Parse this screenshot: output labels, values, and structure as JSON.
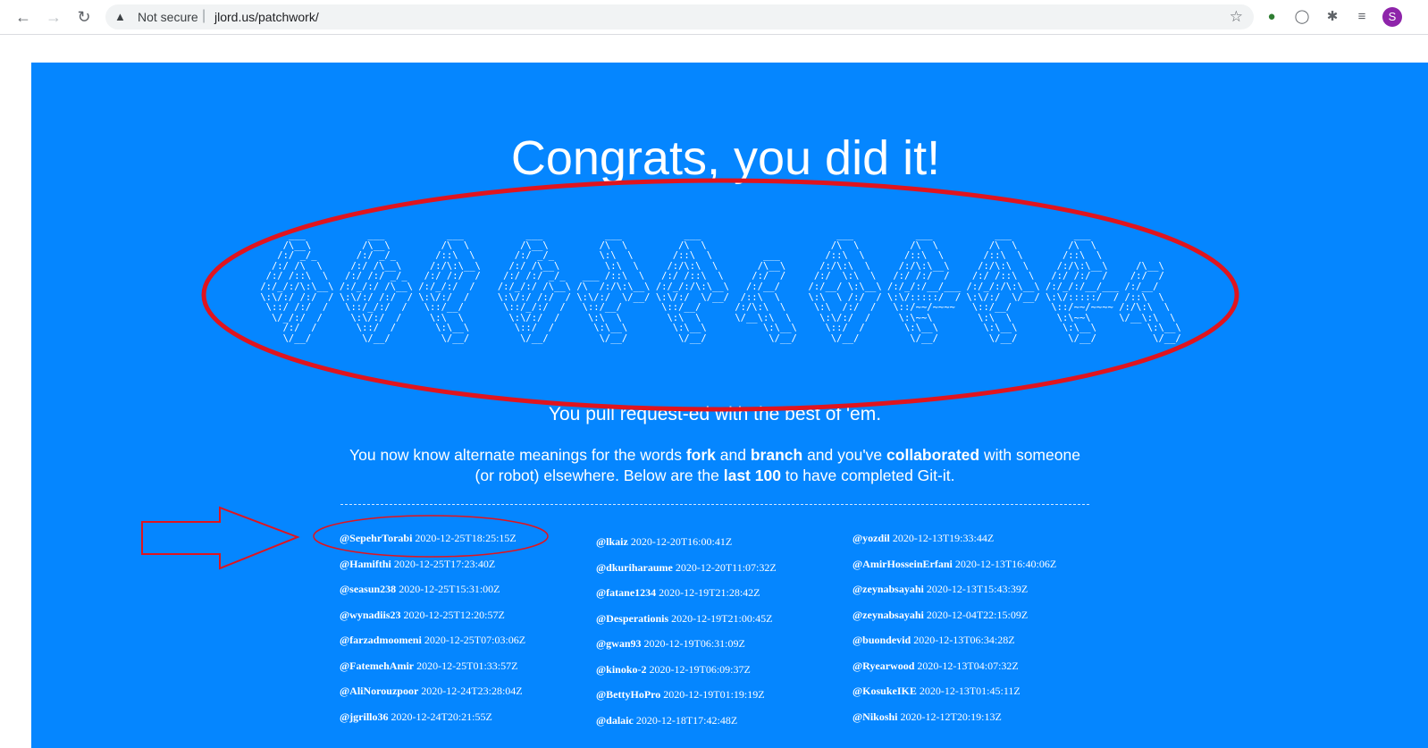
{
  "browser": {
    "back_icon": "arrow-left-icon",
    "forward_icon": "arrow-right-icon",
    "reload_icon": "reload-icon",
    "security_label": "Not secure",
    "separator": "|",
    "url": "jlord.us/patchwork/",
    "profile_initial": "S"
  },
  "page": {
    "title": "Congrats, you did it!",
    "subtitle_prefix": "You ",
    "subtitle_bold": "pull request",
    "subtitle_suffix": "-ed with the best of 'em.",
    "desc_1": "You now know alternate meanings for the words ",
    "desc_fork": "fork",
    "desc_2": " and ",
    "desc_branch": "branch",
    "desc_3": " and you've ",
    "desc_collab": "collaborated",
    "desc_4": " with someone (or robot) elsewhere. Below are the ",
    "desc_last": "last 100",
    "desc_5": " to have completed Git-it.",
    "background_color": "#0586ff"
  },
  "contributors": {
    "col1": [
      {
        "user": "@SepehrTorabi",
        "time": "2020-12-25T18:25:15Z"
      },
      {
        "user": "@Hamifthi",
        "time": "2020-12-25T17:23:40Z"
      },
      {
        "user": "@seasun238",
        "time": "2020-12-25T15:31:00Z"
      },
      {
        "user": "@wynadiis23",
        "time": "2020-12-25T12:20:57Z"
      },
      {
        "user": "@farzadmoomeni",
        "time": "2020-12-25T07:03:06Z"
      },
      {
        "user": "@FatemehAmir",
        "time": "2020-12-25T01:33:57Z"
      },
      {
        "user": "@AliNorouzpoor",
        "time": "2020-12-24T23:28:04Z"
      },
      {
        "user": "@jgrillo36",
        "time": "2020-12-24T20:21:55Z"
      }
    ],
    "col2": [
      {
        "user": "@lkaiz",
        "time": "2020-12-20T16:00:41Z"
      },
      {
        "user": "@dkuriharaume",
        "time": "2020-12-20T11:07:32Z"
      },
      {
        "user": "@fatane1234",
        "time": "2020-12-19T21:28:42Z"
      },
      {
        "user": "@Desperationis",
        "time": "2020-12-19T21:00:45Z"
      },
      {
        "user": "@gwan93",
        "time": "2020-12-19T06:31:09Z"
      },
      {
        "user": "@kinoko-2",
        "time": "2020-12-19T06:09:37Z"
      },
      {
        "user": "@BettyHoPro",
        "time": "2020-12-19T01:19:19Z"
      },
      {
        "user": "@dalaic",
        "time": "2020-12-18T17:42:48Z"
      }
    ],
    "col3": [
      {
        "user": "@yozdil",
        "time": "2020-12-13T19:33:44Z"
      },
      {
        "user": "@AmirHosseinErfani",
        "time": "2020-12-13T16:40:06Z"
      },
      {
        "user": "@zeynabsayahi",
        "time": "2020-12-13T15:43:39Z"
      },
      {
        "user": "@zeynabsayahi",
        "time": "2020-12-04T22:15:09Z"
      },
      {
        "user": "@buondevid",
        "time": "2020-12-13T06:34:28Z"
      },
      {
        "user": "@Ryearwood",
        "time": "2020-12-13T04:07:32Z"
      },
      {
        "user": "@KosukeIKE",
        "time": "2020-12-13T01:45:11Z"
      },
      {
        "user": "@Nikoshi",
        "time": "2020-12-12T20:19:13Z"
      }
    ]
  },
  "annotations": {
    "ellipse_color": "#e0141e",
    "arrow_color": "#e0141e"
  }
}
